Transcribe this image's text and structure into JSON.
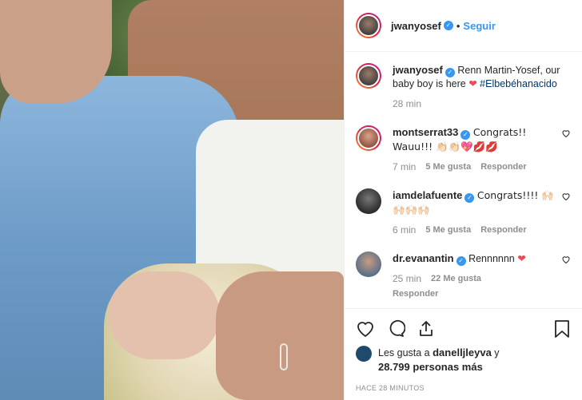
{
  "header": {
    "username": "jwanyosef",
    "follow_label": "Seguir",
    "dot": "•"
  },
  "caption": {
    "username": "jwanyosef",
    "text": "Renn Martin-Yosef, our baby boy is here ",
    "hashtag": "#Elbebéhanacido",
    "time": "28 min"
  },
  "comments": [
    {
      "username": "montserrat33",
      "text": "Congrats!! Wauu!!! 👏🏻👏🏻💖💋💋",
      "time": "7 min",
      "likes": "5 Me gusta",
      "reply": "Responder"
    },
    {
      "username": "iamdelafuente",
      "text": "Congrats!!!! 🙌🏻🙌🏻🙌🏻🙌🏻",
      "time": "6 min",
      "likes": "5 Me gusta",
      "reply": "Responder"
    },
    {
      "username": "dr.evanantin",
      "text": "Rennnnnn ",
      "time": "25 min",
      "likes": "22 Me gusta",
      "reply": "Responder"
    }
  ],
  "likes_line": {
    "prefix": "Les gusta a ",
    "user": "danelljleyva",
    "mid": " y",
    "count": "28.799 personas más"
  },
  "time_ago": "HACE 28 MINUTOS",
  "colors": {
    "accent": "#3897f0",
    "heart": "#ed4956"
  }
}
